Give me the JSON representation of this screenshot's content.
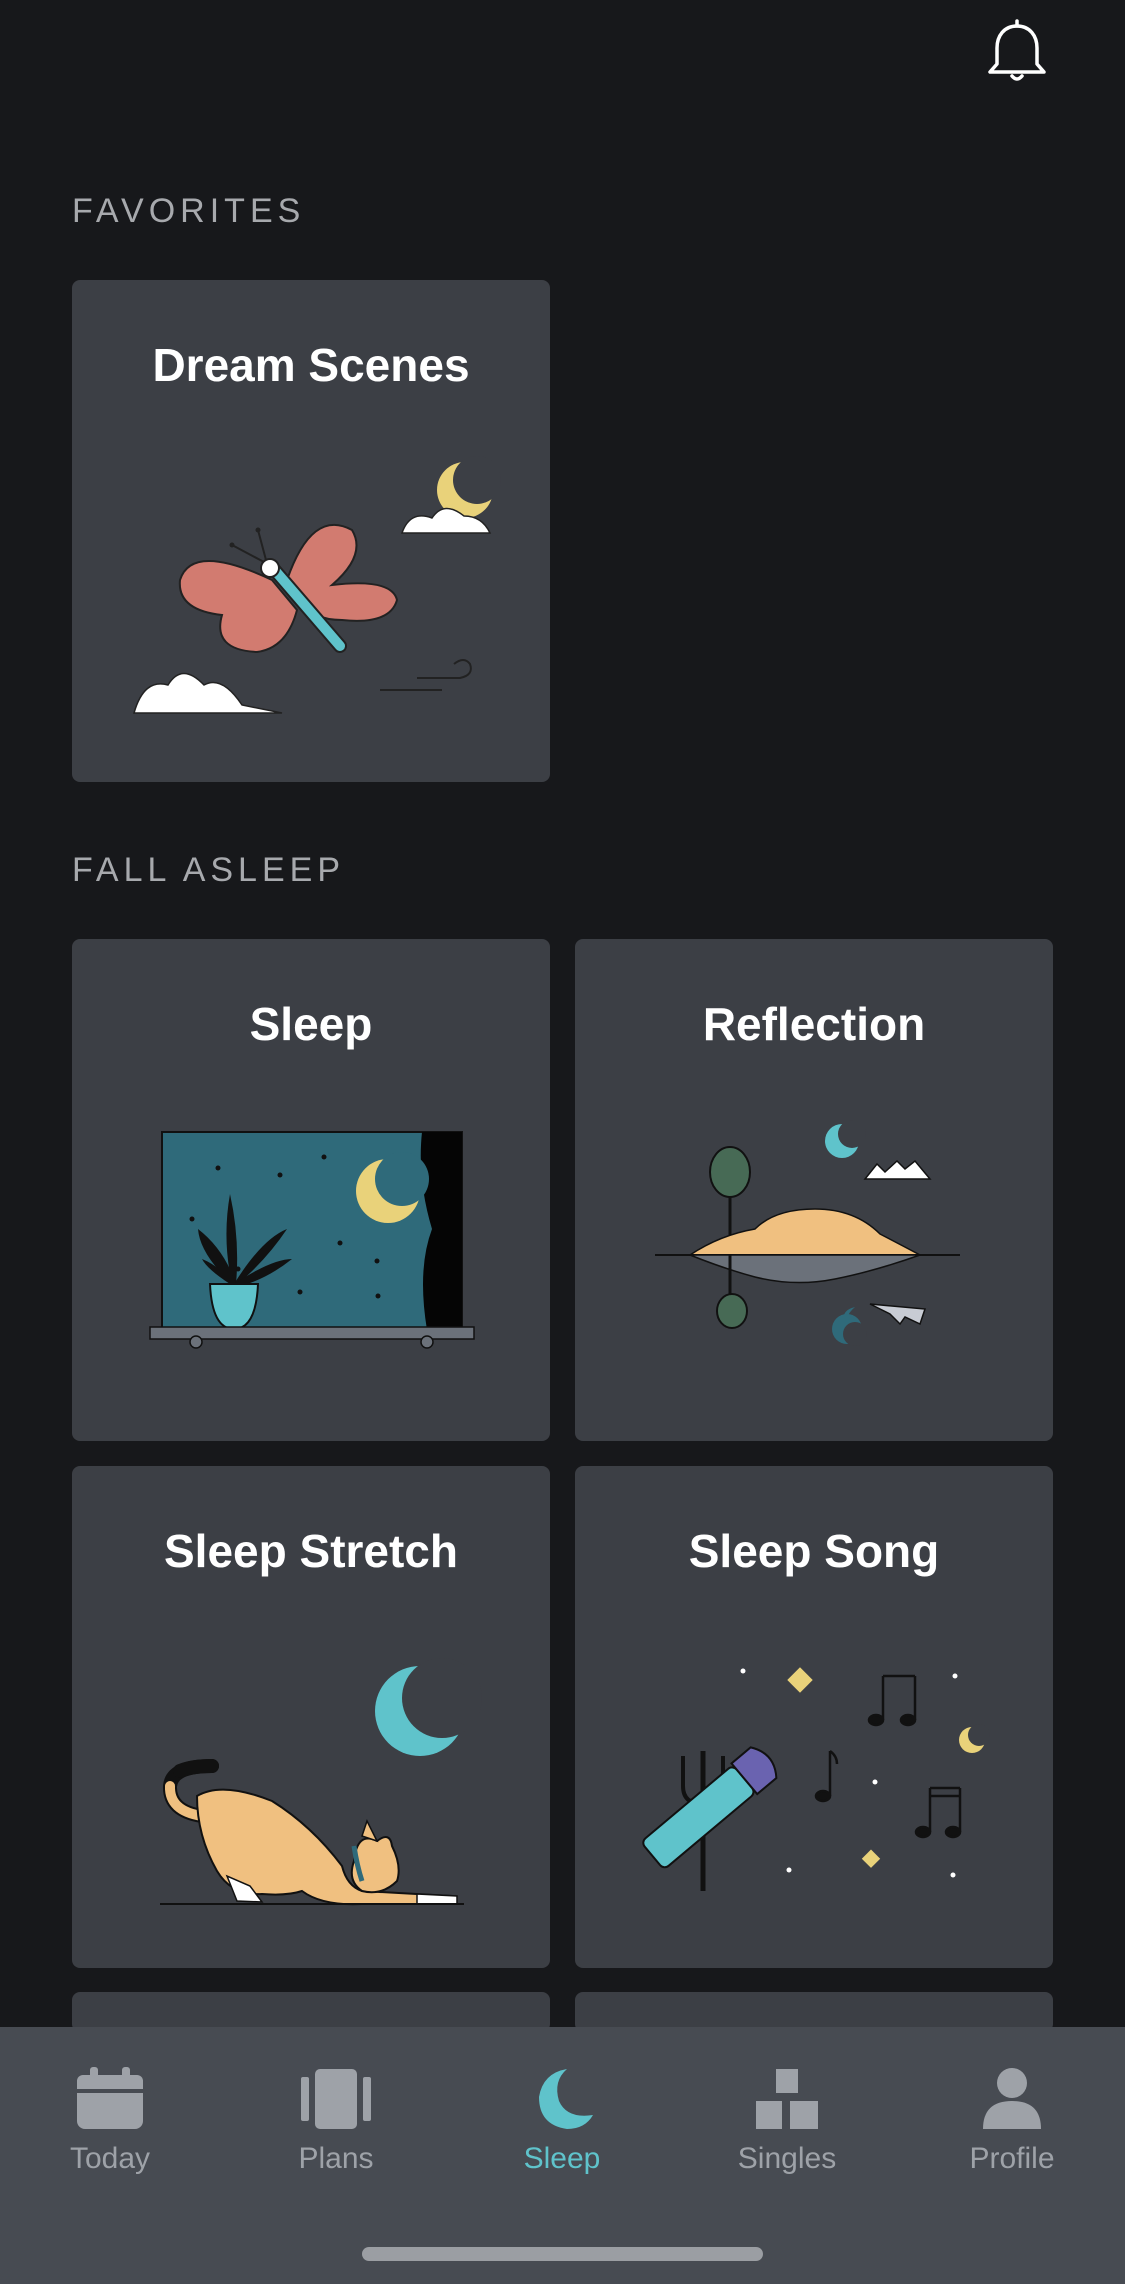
{
  "header": {
    "bell_icon": "bell-icon"
  },
  "favorites": {
    "label": "FAVORITES",
    "cards": [
      {
        "title": "Dream Scenes"
      }
    ]
  },
  "fall_asleep": {
    "label": "FALL ASLEEP",
    "cards": [
      {
        "title": "Sleep"
      },
      {
        "title": "Reflection"
      },
      {
        "title": "Sleep Stretch"
      },
      {
        "title": "Sleep Song"
      }
    ]
  },
  "tabbar": {
    "tabs": [
      {
        "label": "Today",
        "icon": "calendar-icon",
        "active": false
      },
      {
        "label": "Plans",
        "icon": "plans-icon",
        "active": false
      },
      {
        "label": "Sleep",
        "icon": "moon-icon",
        "active": true
      },
      {
        "label": "Singles",
        "icon": "singles-icon",
        "active": false
      },
      {
        "label": "Profile",
        "icon": "profile-icon",
        "active": false
      }
    ]
  },
  "colors": {
    "background": "#17181b",
    "card": "#3c3f45",
    "tabbar": "#474b52",
    "accent": "#5fc3cb",
    "inactive": "#9ea2a8"
  }
}
